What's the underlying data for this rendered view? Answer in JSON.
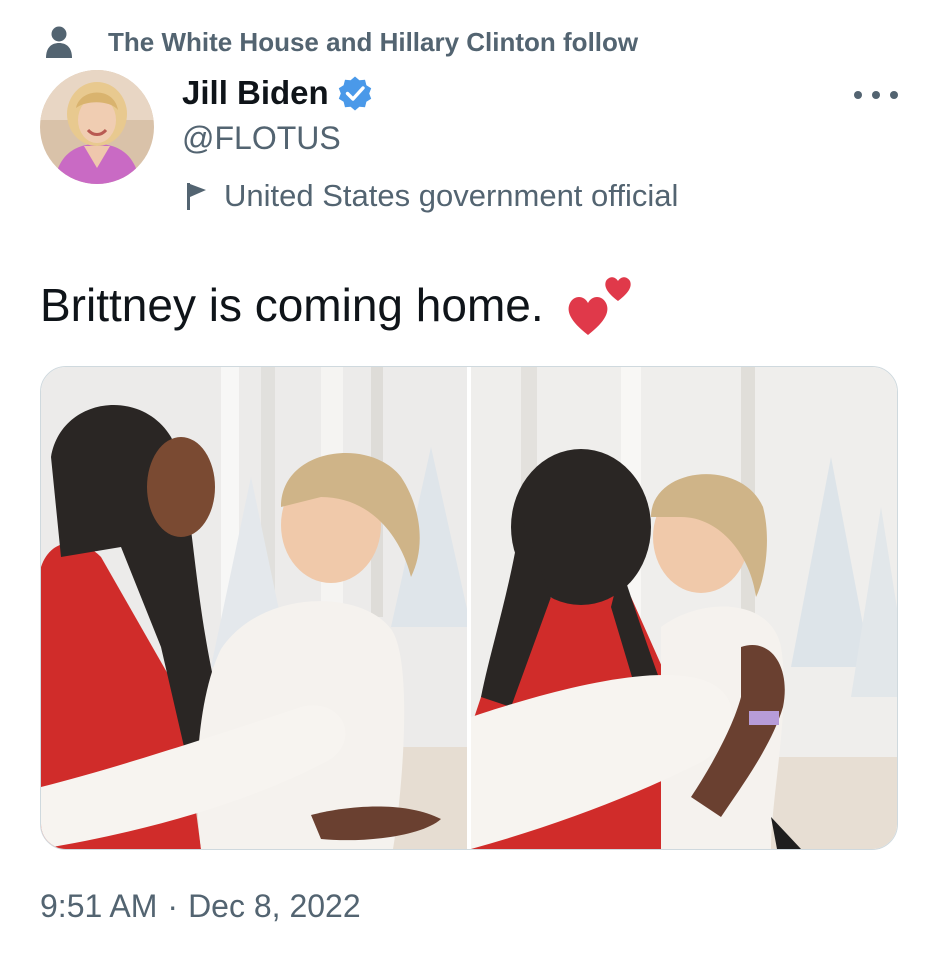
{
  "social_context": {
    "text": "The White House and Hillary Clinton follow",
    "icon": "person-icon"
  },
  "author": {
    "display_name": "Jill Biden",
    "handle": "@FLOTUS",
    "verified": true,
    "verified_color": "#4a99e9",
    "label": "United States government official",
    "label_icon": "flag-icon",
    "avatar": "avatar-photo"
  },
  "more_menu": {
    "icon": "more-dots-icon"
  },
  "tweet": {
    "text": "Brittney is coming home.",
    "emoji": "two-hearts-icon",
    "emoji_color": "#e0394a"
  },
  "media": {
    "photos": [
      {
        "name": "photo-1",
        "description_icon": "photo-icon"
      },
      {
        "name": "photo-2",
        "description_icon": "photo-icon"
      }
    ]
  },
  "meta": {
    "time": "9:51 AM",
    "separator": "·",
    "date": "Dec 8, 2022"
  },
  "colors": {
    "text_primary": "#0f1419",
    "text_secondary": "#536471",
    "border": "#cfd9de"
  }
}
